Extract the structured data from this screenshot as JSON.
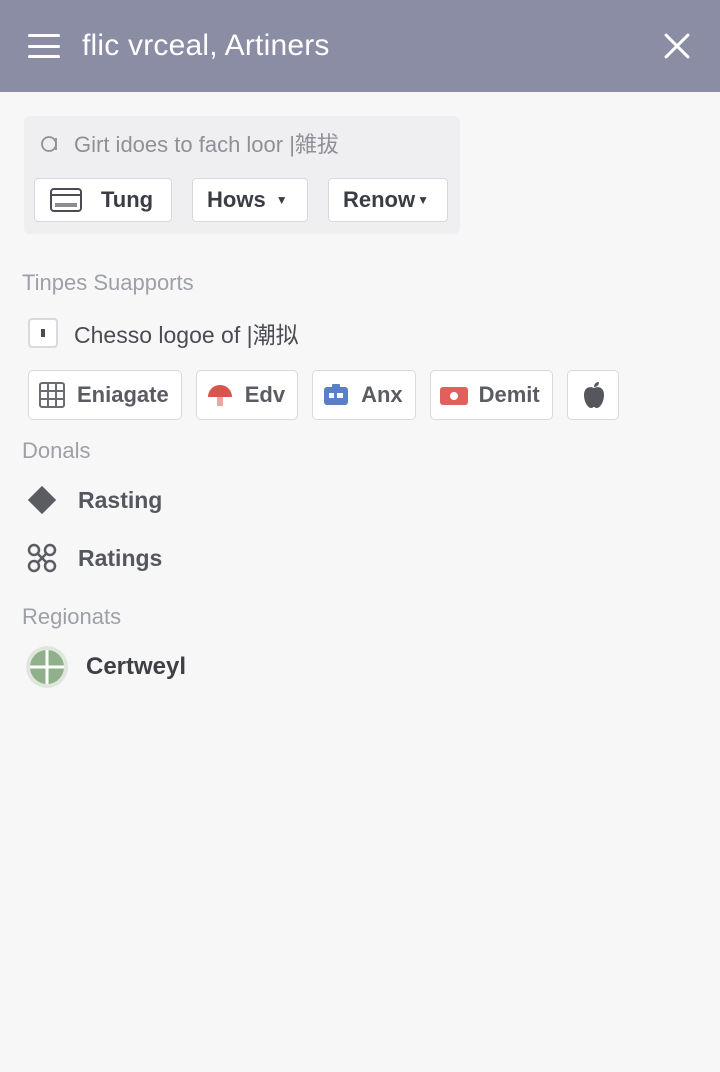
{
  "window": {
    "title": "flic vrceal, Artiners"
  },
  "search": {
    "placeholder": "Girt idoes to fach loor |雑拔"
  },
  "toolbar": {
    "tung_label": "Tung",
    "hows_label": "Hows",
    "renow_label": "Renow"
  },
  "sections": {
    "supports_label": "Tinpes Suapports",
    "checkbox_label": "Chesso logoe of |潮拟",
    "donals_label": "Donals",
    "regionats_label": "Regionats"
  },
  "chips": [
    {
      "label": "Eniagate",
      "icon": "grid-icon"
    },
    {
      "label": "Edv",
      "icon": "mushroom-icon"
    },
    {
      "label": "Anx",
      "icon": "blue-app-icon"
    },
    {
      "label": "Demit",
      "icon": "red-app-icon"
    },
    {
      "label": "",
      "icon": "apple-icon"
    }
  ],
  "donals": [
    {
      "label": "Rasting",
      "icon": "diamond-icon"
    },
    {
      "label": "Ratings",
      "icon": "network-icon"
    }
  ],
  "regions": [
    {
      "label": "Certweyl",
      "icon": "globe-icon"
    }
  ],
  "colors": {
    "titlebar": "#8a8da3",
    "background": "#f7f7f8",
    "accent_red": "#d9534f",
    "accent_blue": "#5b7fc7",
    "globe_green": "#8fb08a"
  }
}
